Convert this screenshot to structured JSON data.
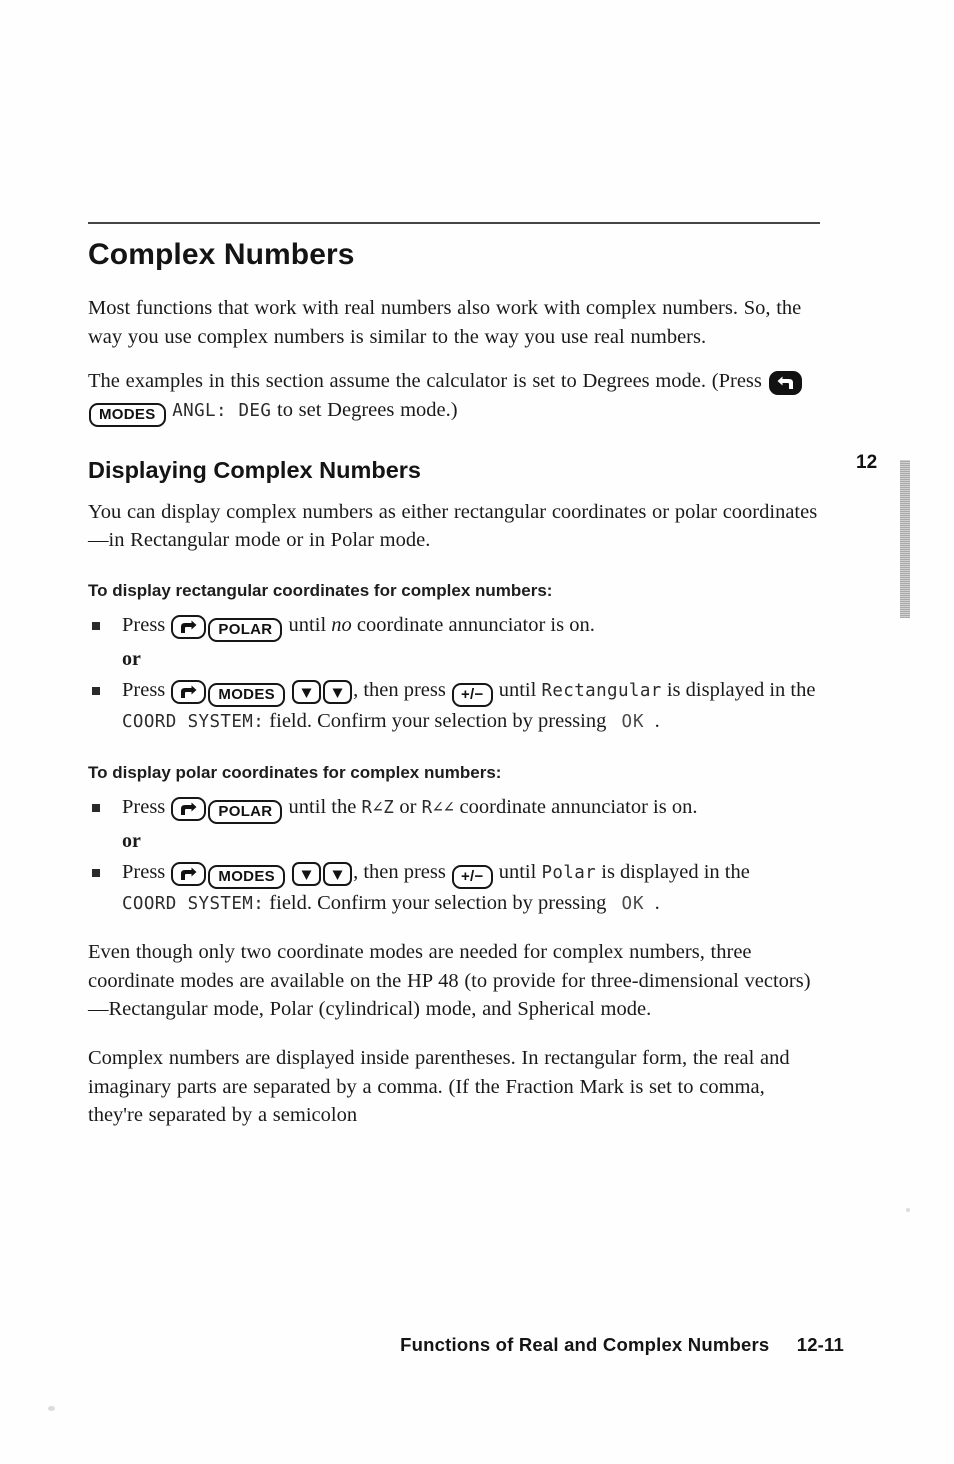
{
  "page": {
    "chapter_tab_number": "12",
    "footer_title": "Functions of Real and Complex Numbers",
    "footer_page": "12-11"
  },
  "headings": {
    "chapter_title": "Complex Numbers",
    "section_title": "Displaying Complex Numbers",
    "sub_rectangular": "To display rectangular coordinates for complex numbers:",
    "sub_polar": "To display polar coordinates for complex numbers:"
  },
  "paragraphs": {
    "intro": "Most functions that work with real numbers also work with complex numbers. So, the way you use complex numbers is similar to the way you use real numbers.",
    "degrees_pre": "The examples in this section assume the calculator is set to Degrees mode. (Press",
    "degrees_post": "to set Degrees mode.)",
    "display_modes": "You can display complex numbers as either rectangular coordinates or polar coordinates—in Rectangular mode or in Polar mode.",
    "three_modes": "Even though only two coordinate modes are needed for complex numbers, three coordinate modes are available on the HP 48 (to provide for three-dimensional vectors)—Rectangular mode, Polar (cylindrical) mode, and Spherical mode.",
    "parentheses": "Complex numbers are displayed inside parentheses. In rectangular form, the real and imaginary parts are separated by a comma. (If the Fraction Mark is set to comma, they're separated by a semicolon"
  },
  "keys": {
    "left_shift": "left-shift-arrow",
    "right_shift": "right-shift-arrow",
    "modes": "MODES",
    "polar": "POLAR",
    "down_arrow": "▼",
    "plus_minus": "+/−"
  },
  "lcd": {
    "angle_deg": "ANGL: DEG",
    "rectangular": "Rectangular",
    "polar": "Polar",
    "coord_system_field": "COORD SYSTEM:",
    "ok_softkey": "OK",
    "annunciator_cylindrical": "R∠Z",
    "annunciator_spherical": "R∠∠"
  },
  "steps_rectangular": {
    "or_label": "or",
    "item1_a": "Press",
    "item1_b": "until",
    "item1_italic": "no",
    "item1_c": "coordinate annunciator is on.",
    "item2_a": "Press",
    "item2_b": ", then press",
    "item2_c": "until",
    "item2_d": "is displayed in the",
    "item2_e": "field. Confirm your selection by pressing",
    "item2_f": "."
  },
  "steps_polar": {
    "or_label": "or",
    "item1_a": "Press",
    "item1_b": "until the",
    "item1_c": "or",
    "item1_d": "coordinate annunciator is on.",
    "item2_a": "Press",
    "item2_b": ", then press",
    "item2_c": "until",
    "item2_d": "is displayed in the",
    "item2_e": "field. Confirm your selection by pressing",
    "item2_f": "."
  },
  "colors": {
    "ink": "#1a1a1a",
    "heading_ink": "#141414",
    "tab_gray": "#c9c9c9"
  }
}
